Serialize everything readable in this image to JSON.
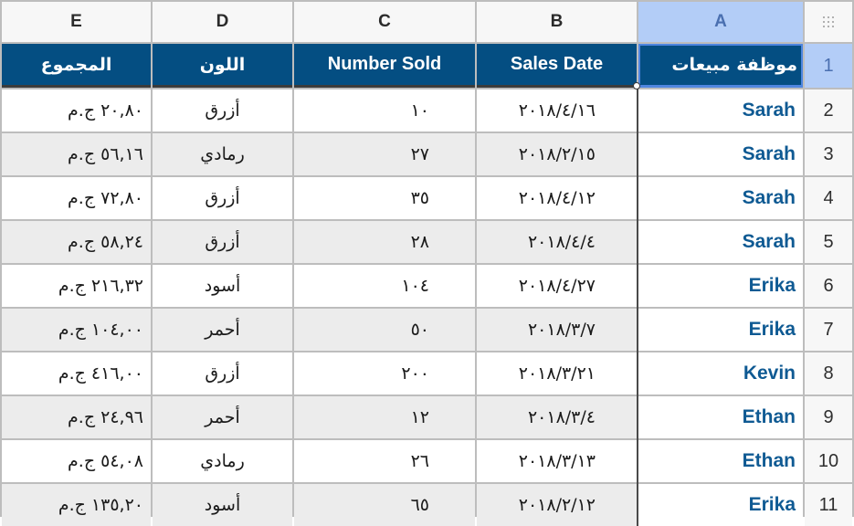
{
  "column_letters": [
    "E",
    "D",
    "C",
    "B",
    "A"
  ],
  "selected_column": "A",
  "corner_icon": "select-all-grid-icon",
  "header_row": {
    "row_number": "1",
    "cells": {
      "E": "المجموع",
      "D": "اللون",
      "C": "Number Sold",
      "B": "Sales Date",
      "A": "موظفة مبيعات"
    }
  },
  "rows": [
    {
      "row_number": "2",
      "name": "Sarah",
      "sales_date": "٢٠١٨/٤/١٦",
      "number_sold": "١٠",
      "color": "أزرق",
      "total": "٢٠,٨٠ ج.م"
    },
    {
      "row_number": "3",
      "name": "Sarah",
      "sales_date": "٢٠١٨/٢/١٥",
      "number_sold": "٢٧",
      "color": "رمادي",
      "total": "٥٦,١٦ ج.م"
    },
    {
      "row_number": "4",
      "name": "Sarah",
      "sales_date": "٢٠١٨/٤/١٢",
      "number_sold": "٣٥",
      "color": "أزرق",
      "total": "٧٢,٨٠ ج.م"
    },
    {
      "row_number": "5",
      "name": "Sarah",
      "sales_date": "٢٠١٨/٤/٤",
      "number_sold": "٢٨",
      "color": "أزرق",
      "total": "٥٨,٢٤ ج.م"
    },
    {
      "row_number": "6",
      "name": "Erika",
      "sales_date": "٢٠١٨/٤/٢٧",
      "number_sold": "١٠٤",
      "color": "أسود",
      "total": "٢١٦,٣٢ ج.م"
    },
    {
      "row_number": "7",
      "name": "Erika",
      "sales_date": "٢٠١٨/٣/٧",
      "number_sold": "٥٠",
      "color": "أحمر",
      "total": "١٠٤,٠٠ ج.م"
    },
    {
      "row_number": "8",
      "name": "Kevin",
      "sales_date": "٢٠١٨/٣/٢١",
      "number_sold": "٢٠٠",
      "color": "أزرق",
      "total": "٤١٦,٠٠ ج.م"
    },
    {
      "row_number": "9",
      "name": "Ethan",
      "sales_date": "٢٠١٨/٣/٤",
      "number_sold": "١٢",
      "color": "أحمر",
      "total": "٢٤,٩٦ ج.م"
    },
    {
      "row_number": "10",
      "name": "Ethan",
      "sales_date": "٢٠١٨/٣/١٣",
      "number_sold": "٢٦",
      "color": "رمادي",
      "total": "٥٤,٠٨ ج.م"
    },
    {
      "row_number": "11",
      "name": "Erika",
      "sales_date": "٢٠١٨/٢/١٢",
      "number_sold": "٦٥",
      "color": "أسود",
      "total": "١٣٥,٢٠ ج.م"
    }
  ],
  "colors": {
    "header_fill": "#044e82",
    "header_text": "#ffffff",
    "name_text": "#0f5a93",
    "selection_fill": "#b3cdf7",
    "selection_border": "#4f86e0",
    "alt_row_fill": "#ececec"
  }
}
